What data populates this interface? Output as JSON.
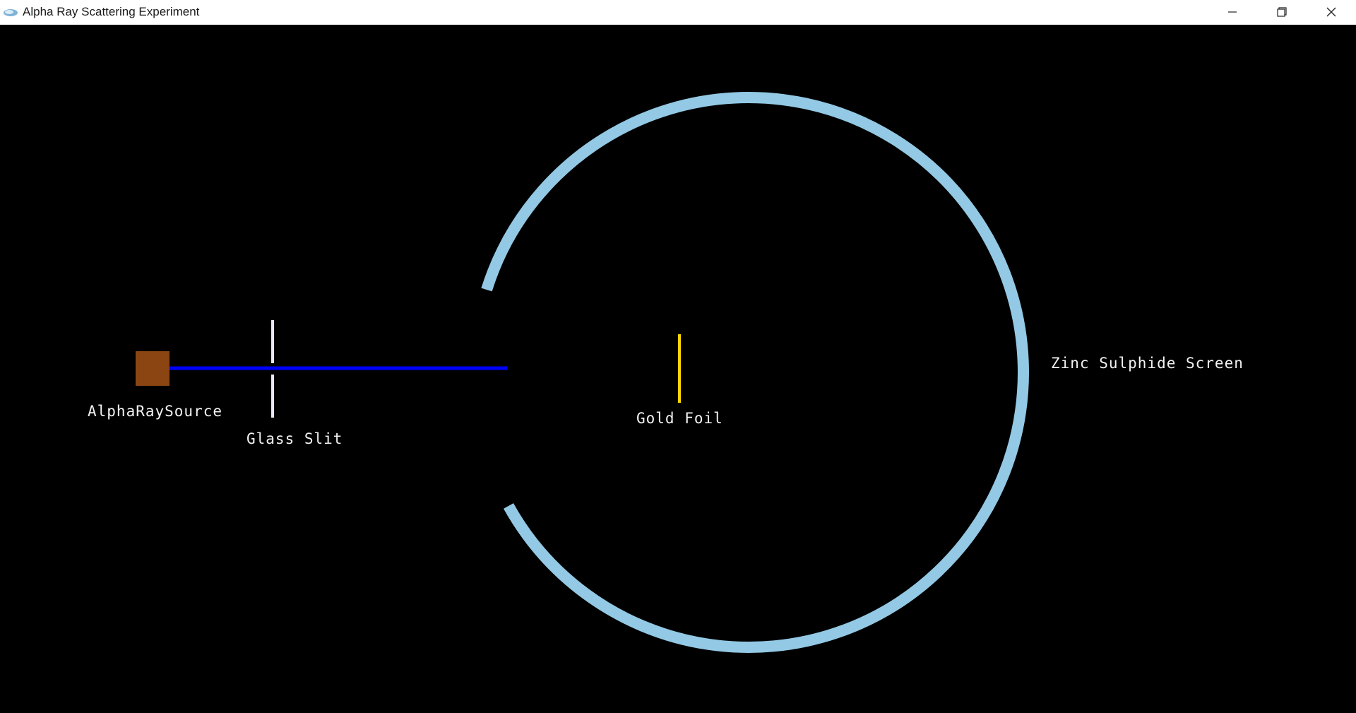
{
  "window": {
    "title": "Alpha Ray Scattering Experiment"
  },
  "icons": {
    "app": "app-icon",
    "minimize": "minimize-icon",
    "maximize": "restore-icon",
    "close": "close-icon"
  },
  "scene": {
    "source_label": "AlphaRaySource",
    "slit_label": "Glass Slit",
    "foil_label": "Gold Foil",
    "screen_label": "Zinc Sulphide Screen"
  },
  "colors": {
    "background": "#000000",
    "source": "#8b4513",
    "beam": "#0000ff",
    "slit": "#e8e8f8",
    "foil": "#ffd700",
    "screen": "#93c9e4",
    "label": "#f2f2f2"
  }
}
